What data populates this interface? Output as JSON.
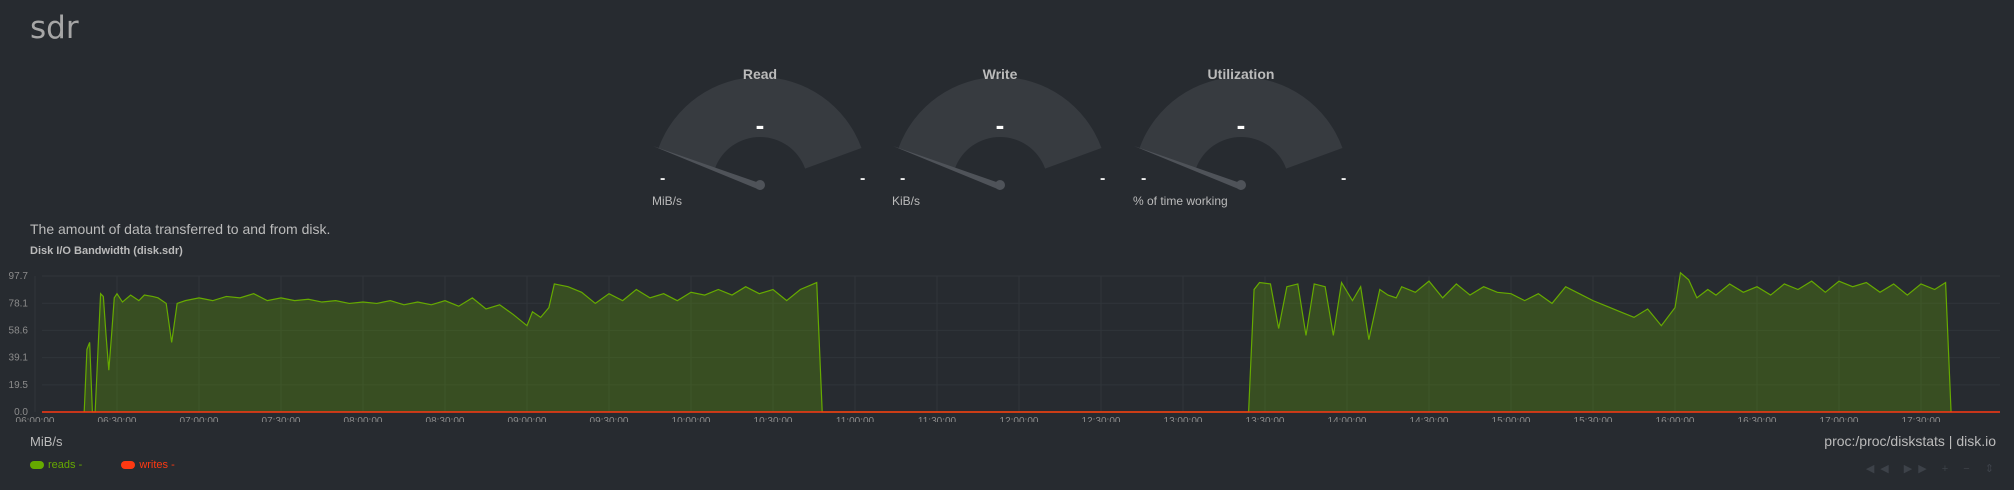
{
  "page": {
    "title": "sdr"
  },
  "gauges": [
    {
      "title": "Read",
      "value": "-",
      "min": "-",
      "max": "-",
      "units": "MiB/s"
    },
    {
      "title": "Write",
      "value": "-",
      "min": "-",
      "max": "-",
      "units": "KiB/s"
    },
    {
      "title": "Utilization",
      "value": "-",
      "min": "-",
      "max": "-",
      "units": "% of time working"
    }
  ],
  "chart_info": "The amount of data transferred to and from disk.",
  "chart_title": "Disk I/O Bandwidth (disk.sdr)",
  "chart_units": "MiB/s",
  "chart_family": "proc:/proc/diskstats | disk.io",
  "legend": [
    {
      "name": "reads",
      "value": "-",
      "color": "#66aa00"
    },
    {
      "name": "writes",
      "value": "-",
      "color": "#fe3912"
    }
  ],
  "toolbox": {
    "icons": [
      "rewind-icon",
      "forward-icon",
      "zoom-in-icon",
      "zoom-out-icon",
      "resize-icon"
    ]
  },
  "chart_data": {
    "type": "area",
    "title": "Disk I/O Bandwidth (disk.sdr)",
    "ylabel": "MiB/s",
    "ylim": [
      0,
      97.7
    ],
    "yticks": [
      "97.7",
      "78.1",
      "58.6",
      "39.1",
      "19.5",
      "0.0"
    ],
    "xticks": [
      "06:00:00",
      "06:30:00",
      "07:00:00",
      "07:30:00",
      "08:00:00",
      "08:30:00",
      "09:00:00",
      "09:30:00",
      "10:00:00",
      "10:30:00",
      "11:00:00",
      "11:30:00",
      "12:00:00",
      "12:30:00",
      "13:00:00",
      "13:30:00",
      "14:00:00",
      "14:30:00",
      "15:00:00",
      "15:30:00",
      "16:00:00",
      "16:30:00",
      "17:00:00",
      "17:30:00"
    ],
    "grid": true,
    "series": [
      {
        "name": "reads",
        "color": "#66aa00",
        "points": [
          [
            "06:18:00",
            0
          ],
          [
            "06:19:00",
            45
          ],
          [
            "06:20:00",
            50
          ],
          [
            "06:21:00",
            0
          ],
          [
            "06:22:00",
            0
          ],
          [
            "06:24:00",
            85
          ],
          [
            "06:25:00",
            83
          ],
          [
            "06:26:00",
            55
          ],
          [
            "06:27:00",
            30
          ],
          [
            "06:28:00",
            55
          ],
          [
            "06:29:00",
            82
          ],
          [
            "06:30:00",
            85
          ],
          [
            "06:32:00",
            79
          ],
          [
            "06:35:00",
            84
          ],
          [
            "06:38:00",
            80
          ],
          [
            "06:40:00",
            84
          ],
          [
            "06:43:00",
            83
          ],
          [
            "06:45:00",
            82
          ],
          [
            "06:48:00",
            78
          ],
          [
            "06:50:00",
            50
          ],
          [
            "06:52:00",
            78
          ],
          [
            "06:55:00",
            80
          ],
          [
            "07:00:00",
            82
          ],
          [
            "07:05:00",
            80
          ],
          [
            "07:10:00",
            83
          ],
          [
            "07:15:00",
            82
          ],
          [
            "07:20:00",
            85
          ],
          [
            "07:25:00",
            80
          ],
          [
            "07:30:00",
            82
          ],
          [
            "07:35:00",
            80
          ],
          [
            "07:40:00",
            81
          ],
          [
            "07:45:00",
            79
          ],
          [
            "07:50:00",
            80
          ],
          [
            "07:55:00",
            78
          ],
          [
            "08:00:00",
            79
          ],
          [
            "08:05:00",
            78
          ],
          [
            "08:10:00",
            80
          ],
          [
            "08:15:00",
            77
          ],
          [
            "08:20:00",
            79
          ],
          [
            "08:25:00",
            77
          ],
          [
            "08:30:00",
            80
          ],
          [
            "08:35:00",
            76
          ],
          [
            "08:40:00",
            82
          ],
          [
            "08:45:00",
            74
          ],
          [
            "08:50:00",
            77
          ],
          [
            "08:55:00",
            70
          ],
          [
            "09:00:00",
            62
          ],
          [
            "09:02:00",
            72
          ],
          [
            "09:05:00",
            68
          ],
          [
            "09:08:00",
            75
          ],
          [
            "09:10:00",
            92
          ],
          [
            "09:15:00",
            90
          ],
          [
            "09:20:00",
            86
          ],
          [
            "09:25:00",
            78
          ],
          [
            "09:30:00",
            85
          ],
          [
            "09:35:00",
            80
          ],
          [
            "09:40:00",
            88
          ],
          [
            "09:45:00",
            82
          ],
          [
            "09:50:00",
            85
          ],
          [
            "09:55:00",
            80
          ],
          [
            "10:00:00",
            86
          ],
          [
            "10:05:00",
            84
          ],
          [
            "10:10:00",
            88
          ],
          [
            "10:15:00",
            84
          ],
          [
            "10:20:00",
            90
          ],
          [
            "10:25:00",
            85
          ],
          [
            "10:30:00",
            88
          ],
          [
            "10:35:00",
            80
          ],
          [
            "10:40:00",
            88
          ],
          [
            "10:46:00",
            93
          ],
          [
            "10:48:00",
            0
          ],
          [
            "13:24:00",
            0
          ],
          [
            "13:26:00",
            88
          ],
          [
            "13:28:00",
            93
          ],
          [
            "13:32:00",
            92
          ],
          [
            "13:35:00",
            60
          ],
          [
            "13:38:00",
            90
          ],
          [
            "13:42:00",
            92
          ],
          [
            "13:45:00",
            55
          ],
          [
            "13:48:00",
            92
          ],
          [
            "13:52:00",
            90
          ],
          [
            "13:55:00",
            55
          ],
          [
            "13:58:00",
            93
          ],
          [
            "14:02:00",
            80
          ],
          [
            "14:05:00",
            90
          ],
          [
            "14:08:00",
            52
          ],
          [
            "14:12:00",
            88
          ],
          [
            "14:15:00",
            84
          ],
          [
            "14:18:00",
            82
          ],
          [
            "14:20:00",
            90
          ],
          [
            "14:25:00",
            86
          ],
          [
            "14:30:00",
            94
          ],
          [
            "14:35:00",
            82
          ],
          [
            "14:40:00",
            92
          ],
          [
            "14:45:00",
            84
          ],
          [
            "14:50:00",
            90
          ],
          [
            "14:55:00",
            86
          ],
          [
            "15:00:00",
            85
          ],
          [
            "15:05:00",
            80
          ],
          [
            "15:10:00",
            85
          ],
          [
            "15:15:00",
            78
          ],
          [
            "15:20:00",
            90
          ],
          [
            "15:25:00",
            85
          ],
          [
            "15:30:00",
            80
          ],
          [
            "15:35:00",
            76
          ],
          [
            "15:40:00",
            72
          ],
          [
            "15:45:00",
            68
          ],
          [
            "15:50:00",
            74
          ],
          [
            "15:55:00",
            62
          ],
          [
            "16:00:00",
            75
          ],
          [
            "16:02:00",
            100
          ],
          [
            "16:05:00",
            95
          ],
          [
            "16:08:00",
            82
          ],
          [
            "16:12:00",
            88
          ],
          [
            "16:15:00",
            84
          ],
          [
            "16:20:00",
            92
          ],
          [
            "16:25:00",
            86
          ],
          [
            "16:30:00",
            90
          ],
          [
            "16:35:00",
            84
          ],
          [
            "16:40:00",
            92
          ],
          [
            "16:45:00",
            88
          ],
          [
            "16:50:00",
            94
          ],
          [
            "16:55:00",
            86
          ],
          [
            "17:00:00",
            94
          ],
          [
            "17:05:00",
            90
          ],
          [
            "17:10:00",
            93
          ],
          [
            "17:15:00",
            86
          ],
          [
            "17:20:00",
            92
          ],
          [
            "17:25:00",
            84
          ],
          [
            "17:30:00",
            92
          ],
          [
            "17:35:00",
            88
          ],
          [
            "17:39:00",
            93
          ],
          [
            "17:41:00",
            0
          ]
        ]
      },
      {
        "name": "writes",
        "color": "#fe3912",
        "points": [
          [
            "05:58:00",
            0
          ],
          [
            "18:00:00",
            0
          ]
        ]
      }
    ]
  }
}
